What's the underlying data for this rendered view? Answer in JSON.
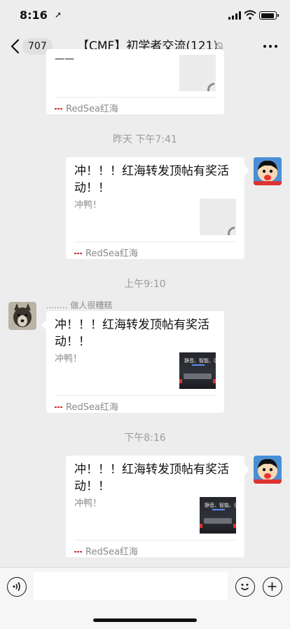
{
  "status_bar": {
    "time": "8:16"
  },
  "nav": {
    "unread_count": "707",
    "title": "【CMF】初学者交流(121)"
  },
  "messages": {
    "top_card": {
      "source": "RedSea红海"
    },
    "ts1": "昨天 下午7:41",
    "card1": {
      "title": "冲！！！红海转发顶帖有奖活动！！",
      "desc": "冲鸭！",
      "source": "RedSea红海"
    },
    "ts2": "上午9:10",
    "card2": {
      "sender": "........ 做人很糟糕",
      "title": "冲！！！红海转发顶帖有奖活动！！",
      "desc": "冲鸭！",
      "source": "RedSea红海",
      "thumb_text": "静音、智能、强劲"
    },
    "ts3": "下午8:16",
    "card3": {
      "title": "冲！！！红海转发顶帖有奖活动！！",
      "desc": "冲鸭！",
      "source": "RedSea红海",
      "thumb_text": "静音、智能、强劲"
    }
  },
  "input_bar": {
    "placeholder": ""
  }
}
